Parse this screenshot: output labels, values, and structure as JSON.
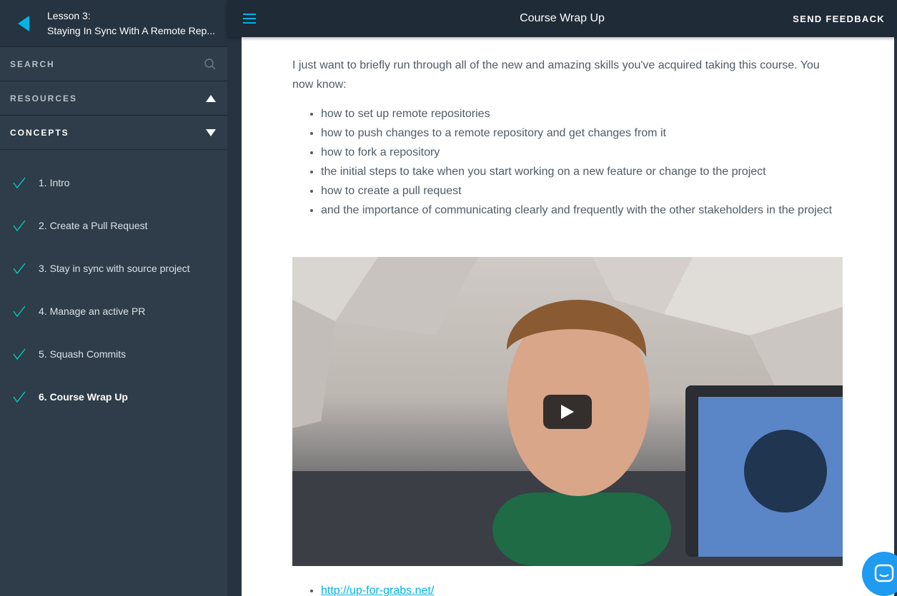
{
  "sidebar": {
    "lesson_label": "Lesson 3:",
    "lesson_title": "Staying In Sync With A Remote Rep...",
    "search_label": "SEARCH",
    "resources_label": "RESOURCES",
    "concepts_label": "CONCEPTS",
    "concepts": [
      {
        "label": "1. Intro",
        "completed": true
      },
      {
        "label": "2. Create a Pull Request",
        "completed": true
      },
      {
        "label": "3. Stay in sync with source project",
        "completed": true
      },
      {
        "label": "4. Manage an active PR",
        "completed": true
      },
      {
        "label": "5. Squash Commits",
        "completed": true
      },
      {
        "label": "6. Course Wrap Up",
        "completed": true,
        "active": true
      }
    ]
  },
  "header": {
    "title": "Course Wrap Up",
    "feedback_label": "SEND FEEDBACK"
  },
  "main": {
    "intro": "I just want to briefly run through all of the new and amazing skills you've acquired taking this course. You now know:",
    "skills": [
      "how to set up remote repositories",
      "how to push changes to a remote repository and get changes from it",
      "how to fork a repository",
      "the initial steps to take when you start working on a new feature or change to the project",
      "how to create a pull request",
      "and the importance of communicating clearly and frequently with the other stakeholders in the project"
    ],
    "links": [
      "http://up-for-grabs.net/"
    ]
  },
  "colors": {
    "accent": "#02b3e4",
    "check": "#02ccba",
    "sidebar_bg": "#2e3d49",
    "topbar_bg": "#1f2b37"
  },
  "icons": {
    "back": "back-triangle-icon",
    "search": "search-icon",
    "resources": "triangle-up-icon",
    "concepts": "triangle-down-icon",
    "concept_status": "checkmark-icon",
    "menu": "hamburger-menu-icon",
    "video": "play-icon",
    "chat": "chat-bubble-icon"
  }
}
